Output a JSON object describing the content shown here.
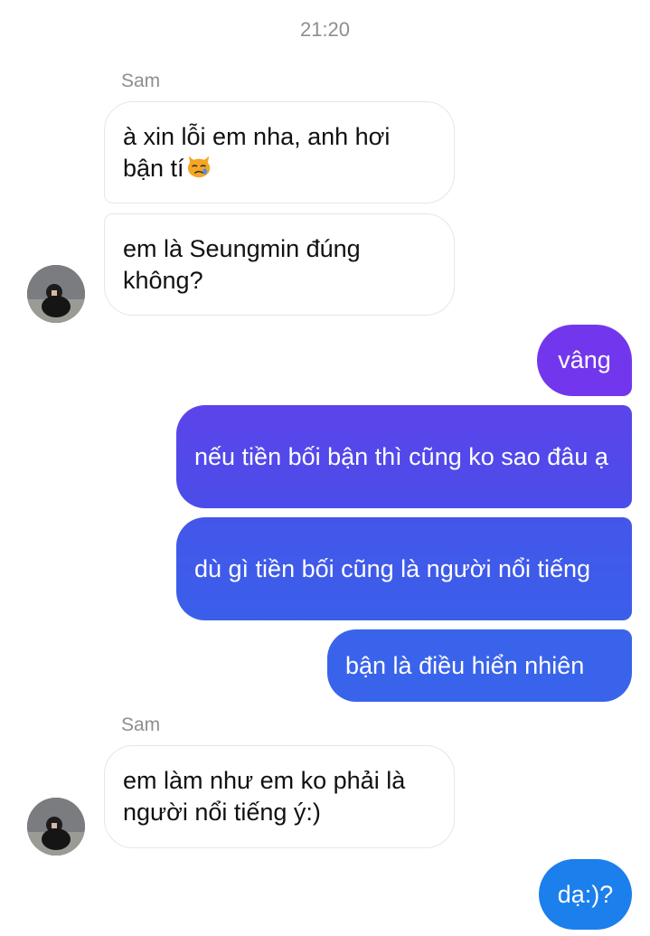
{
  "conversation": {
    "timestamp": "21:20",
    "contact_name": "Sam",
    "messages": [
      {
        "sender": "Sam",
        "text": "à xin lỗi em nha, anh hơi bận tí",
        "emoji": "crying-cat-face"
      },
      {
        "sender": "Sam",
        "text": "em là Seungmin đúng không?"
      },
      {
        "sender": "me",
        "text": "vâng"
      },
      {
        "sender": "me",
        "text": "nếu tiền bối bận thì cũng ko sao đâu ạ"
      },
      {
        "sender": "me",
        "text": "dù gì tiền bối cũng là người nổi tiếng"
      },
      {
        "sender": "me",
        "text": "bận là điều hiển nhiên"
      },
      {
        "sender": "Sam",
        "text": "em làm như em ko phải là người nổi tiếng ý:)"
      },
      {
        "sender": "me",
        "text": "dạ:)?"
      }
    ]
  },
  "colors": {
    "gradient_top": "#7436ee",
    "gradient_bottom": "#1a7fec",
    "incoming_bg": "#ffffff",
    "incoming_border": "#e6e6e6",
    "meta_text": "#8e8e93"
  }
}
